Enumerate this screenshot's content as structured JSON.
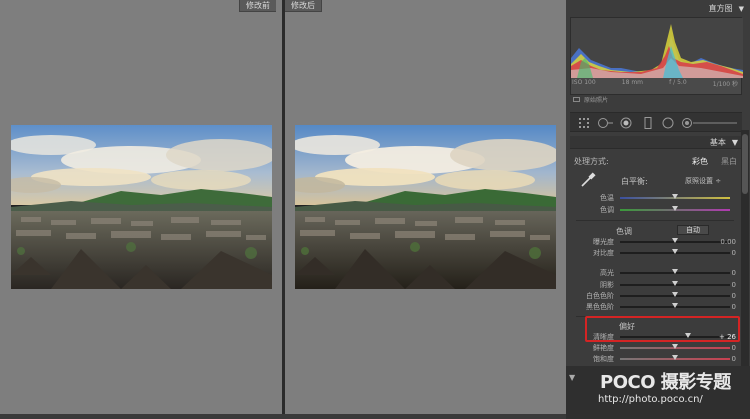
{
  "compare": {
    "before_label": "修改前",
    "after_label": "修改后"
  },
  "panel": {
    "histogram_title": "直方图",
    "histogram_stats": [
      "ISO 100",
      "18 mm",
      "f / 5.0",
      "1/100 秒"
    ],
    "original_photo_label": "原始照片",
    "basic_title": "基本",
    "treatment_label": "处理方式:",
    "treatment_color": "彩色",
    "treatment_bw": "黑白",
    "white_balance_label": "白平衡:",
    "white_balance_value": "原照设置 ÷",
    "wb_sliders": [
      {
        "label": "色温",
        "value": "",
        "pos": 0.5
      },
      {
        "label": "色调",
        "value": "",
        "pos": 0.5
      }
    ],
    "tone_label": "色调",
    "auto_label": "自动",
    "tone_sliders": [
      {
        "label": "曝光度",
        "value": "0.00",
        "pos": 0.5
      },
      {
        "label": "对比度",
        "value": "0",
        "pos": 0.5
      }
    ],
    "light_sliders": [
      {
        "label": "高光",
        "value": "0",
        "pos": 0.5
      },
      {
        "label": "阴影",
        "value": "0",
        "pos": 0.5
      },
      {
        "label": "白色色阶",
        "value": "0",
        "pos": 0.5
      },
      {
        "label": "黑色色阶",
        "value": "0",
        "pos": 0.5
      }
    ],
    "presence_label": "偏好",
    "presence_sliders": [
      {
        "label": "清晰度",
        "value": "+ 26",
        "pos": 0.62
      },
      {
        "label": "鲜艳度",
        "value": "0",
        "pos": 0.5
      },
      {
        "label": "饱和度",
        "value": "0",
        "pos": 0.5
      }
    ]
  },
  "watermark": {
    "brand": "POCO 摄影专题",
    "url": "http://photo.poco.cn/"
  }
}
